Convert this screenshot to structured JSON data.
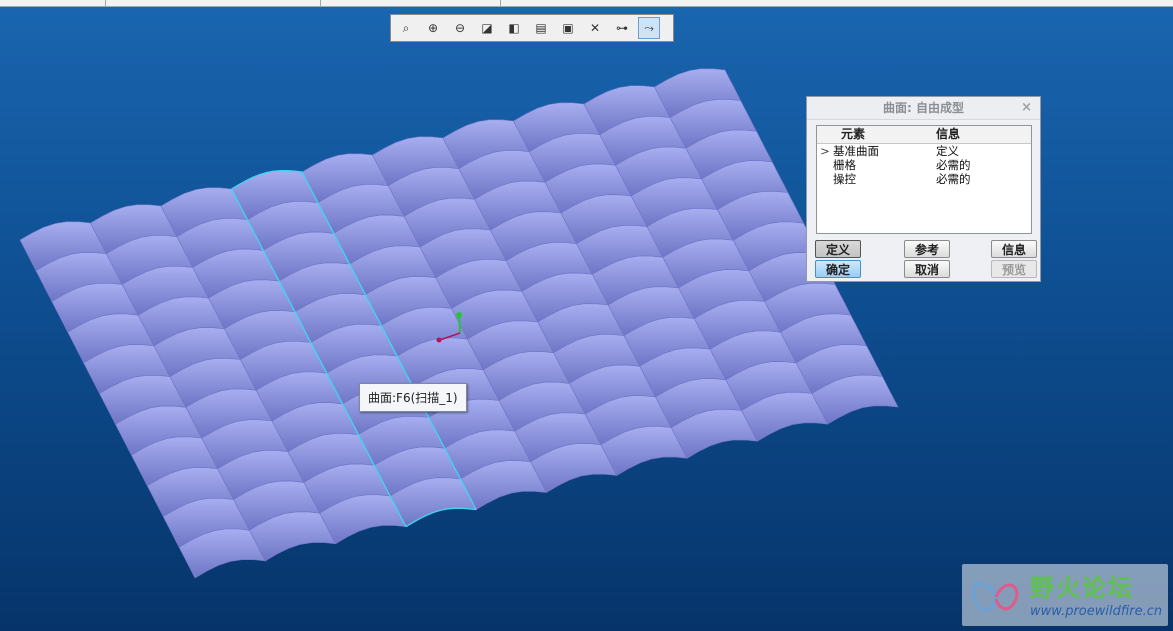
{
  "toolbar": {
    "buttons": [
      {
        "name": "refit",
        "glyph": "⌕",
        "active": false
      },
      {
        "name": "zoom-in",
        "glyph": "⊕",
        "active": false
      },
      {
        "name": "zoom-out",
        "glyph": "⊖",
        "active": false
      },
      {
        "name": "repaint",
        "glyph": "◪",
        "active": false
      },
      {
        "name": "display-style",
        "glyph": "◧",
        "active": false
      },
      {
        "name": "saved-views",
        "glyph": "▤",
        "active": false
      },
      {
        "name": "view-manager",
        "glyph": "▣",
        "active": false
      },
      {
        "name": "datum-display",
        "glyph": "✕",
        "active": false
      },
      {
        "name": "annotation-display",
        "glyph": "⊶",
        "active": false
      },
      {
        "name": "spin-center",
        "glyph": "⤳",
        "active": true
      }
    ]
  },
  "tooltip": {
    "text": "曲面:F6(扫描_1)"
  },
  "dialog": {
    "title": "曲面: 自由成型",
    "close": "×",
    "columns": [
      "元素",
      "信息"
    ],
    "rows": [
      {
        "marker": ">",
        "element": "基准曲面",
        "info": "定义"
      },
      {
        "marker": "",
        "element": "栅格",
        "info": "必需的"
      },
      {
        "marker": "",
        "element": "操控",
        "info": "必需的"
      }
    ],
    "buttons": {
      "define": "定义",
      "reference": "参考",
      "info": "信息",
      "ok": "确定",
      "cancel": "取消",
      "preview": "预览"
    }
  },
  "watermark": {
    "title": "野火论坛",
    "url": "www.proewildfire.cn"
  },
  "colors": {
    "surface_light": "#a7aef0",
    "surface_dark": "#6e76c6",
    "highlight": "#3fd6f0",
    "axis_y": "#27c23a",
    "axis_x": "#b0145a"
  }
}
